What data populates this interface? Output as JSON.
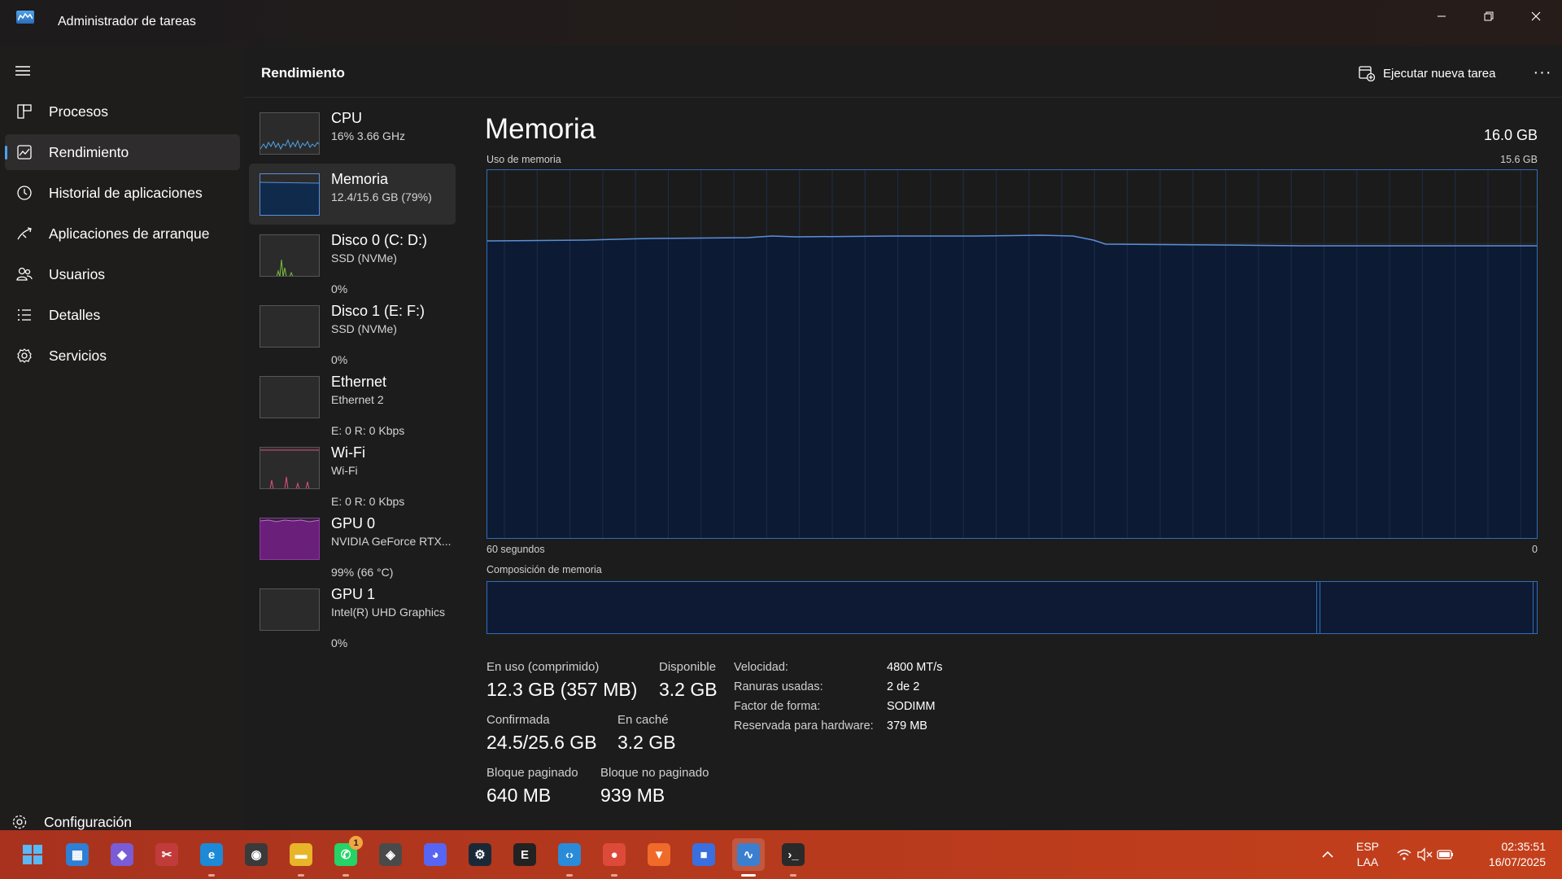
{
  "window": {
    "title": "Administrador de tareas"
  },
  "nav": {
    "items": [
      {
        "label": "Procesos",
        "icon": "processes-icon"
      },
      {
        "label": "Rendimiento",
        "icon": "performance-icon",
        "active": true
      },
      {
        "label": "Historial de aplicaciones",
        "icon": "app-history-icon"
      },
      {
        "label": "Aplicaciones de arranque",
        "icon": "startup-apps-icon"
      },
      {
        "label": "Usuarios",
        "icon": "users-icon"
      },
      {
        "label": "Detalles",
        "icon": "details-icon"
      },
      {
        "label": "Servicios",
        "icon": "services-icon"
      }
    ],
    "settings_label": "Configuración"
  },
  "header": {
    "title": "Rendimiento",
    "run_task_label": "Ejecutar nueva tarea",
    "more": "···"
  },
  "devices": [
    {
      "name": "CPU",
      "line1": "16%  3.66 GHz",
      "line2": "",
      "color": "#4fa3e8"
    },
    {
      "name": "Memoria",
      "line1": "12.4/15.6 GB (79%)",
      "line2": "",
      "color": "#5b8fd6",
      "active": true
    },
    {
      "name": "Disco 0 (C: D:)",
      "line1": "SSD (NVMe)",
      "line2": "0%",
      "color": "#7bbf3a"
    },
    {
      "name": "Disco 1 (E: F:)",
      "line1": "SSD (NVMe)",
      "line2": "0%",
      "color": "#7bbf3a"
    },
    {
      "name": "Ethernet",
      "line1": "Ethernet 2",
      "line2": "E: 0 R: 0 Kbps",
      "color": "#c7589c"
    },
    {
      "name": "Wi-Fi",
      "line1": "Wi-Fi",
      "line2": "E: 0 R: 0 Kbps",
      "color": "#e0507f"
    },
    {
      "name": "GPU 0",
      "line1": "NVIDIA GeForce RTX...",
      "line2": "99%  (66 °C)",
      "color": "#a33ac0"
    },
    {
      "name": "GPU 1",
      "line1": "Intel(R) UHD Graphics",
      "line2": "0%",
      "color": "#a33ac0"
    }
  ],
  "memory": {
    "title": "Memoria",
    "total": "16.0 GB",
    "usage_caption": "Uso de memoria",
    "usage_max": "15.6 GB",
    "time_label": "60 segundos",
    "zero_label": "0",
    "composition_caption": "Composición de memoria",
    "composition_in_use_fraction": 0.79,
    "stats": {
      "in_use_label": "En uso (comprimido)",
      "in_use_value": "12.3 GB (357 MB)",
      "available_label": "Disponible",
      "available_value": "3.2 GB",
      "committed_label": "Confirmada",
      "committed_value": "24.5/25.6 GB",
      "cached_label": "En caché",
      "cached_value": "3.2 GB",
      "paged_label": "Bloque paginado",
      "paged_value": "640 MB",
      "nonpaged_label": "Bloque no paginado",
      "nonpaged_value": "939 MB"
    },
    "props": [
      {
        "key": "Velocidad:",
        "value": "4800 MT/s"
      },
      {
        "key": "Ranuras usadas:",
        "value": "2 de 2"
      },
      {
        "key": "Factor de forma:",
        "value": "SODIMM"
      },
      {
        "key": "Reservada para hardware:",
        "value": "379 MB"
      }
    ]
  },
  "taskbar": {
    "apps": [
      {
        "name": "start-button",
        "color": "#3aa0f0"
      },
      {
        "name": "microsoft-store",
        "color": "#2f7fd4"
      },
      {
        "name": "copilot",
        "color": "#7a5cd6"
      },
      {
        "name": "snipping-tool",
        "color": "#c23b3b"
      },
      {
        "name": "edge",
        "color": "#1c8ad6"
      },
      {
        "name": "obs-studio",
        "color": "#3a3a3a"
      },
      {
        "name": "file-explorer",
        "color": "#e8b428"
      },
      {
        "name": "whatsapp",
        "color": "#25d366",
        "badge": "1"
      },
      {
        "name": "unity",
        "color": "#4a4a4a"
      },
      {
        "name": "discord",
        "color": "#5865f2"
      },
      {
        "name": "steam",
        "color": "#1b2838"
      },
      {
        "name": "epic-games",
        "color": "#222222"
      },
      {
        "name": "vs-code",
        "color": "#2a8bd8"
      },
      {
        "name": "chrome",
        "color": "#de4a3a"
      },
      {
        "name": "brave",
        "color": "#f06a2a"
      },
      {
        "name": "roblox",
        "color": "#3a6fe0"
      },
      {
        "name": "task-manager",
        "color": "#3b7fd0",
        "active": true
      },
      {
        "name": "terminal",
        "color": "#2a2a2a"
      }
    ],
    "lang_line1": "ESP",
    "lang_line2": "LAA",
    "time": "02:35:51",
    "date": "16/07/2025"
  }
}
